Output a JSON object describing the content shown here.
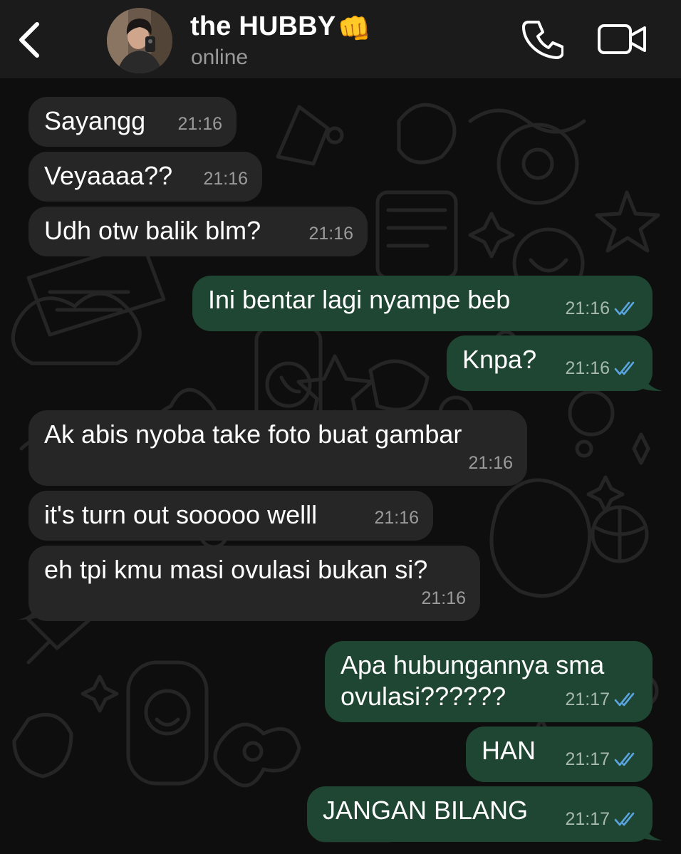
{
  "header": {
    "contact_name": "the HUBBY",
    "contact_emoji": "👊",
    "status": "online",
    "icons": {
      "back": "chevron-left-icon",
      "call": "phone-icon",
      "video": "video-camera-icon"
    }
  },
  "messages": [
    {
      "direction": "in",
      "text": "Sayangg",
      "time": "21:16"
    },
    {
      "direction": "in",
      "text": "Veyaaaa??",
      "time": "21:16"
    },
    {
      "direction": "in",
      "text": "Udh otw balik blm?",
      "time": "21:16"
    },
    {
      "direction": "out",
      "text": "Ini bentar lagi nyampe beb",
      "time": "21:16",
      "read": true
    },
    {
      "direction": "out",
      "text": "Knpa?",
      "time": "21:16",
      "read": true
    },
    {
      "direction": "in",
      "text": "Ak abis nyoba take foto buat gambar",
      "time": "21:16"
    },
    {
      "direction": "in",
      "text": "it's turn out sooooo welll",
      "time": "21:16"
    },
    {
      "direction": "in",
      "text": "eh tpi kmu masi ovulasi bukan si?",
      "time": "21:16"
    },
    {
      "direction": "out",
      "text": "Apa hubungannya sma\novulasi??????",
      "time": "21:17",
      "read": true
    },
    {
      "direction": "out",
      "text": "HAN",
      "time": "21:17",
      "read": true
    },
    {
      "direction": "out",
      "text": "JANGAN BILANG",
      "time": "21:17",
      "read": true
    }
  ],
  "colors": {
    "header_bg": "#1b1b1b",
    "incoming_bubble": "#262626",
    "outgoing_bubble": "#1e4632",
    "read_ticks": "#5aa4e0"
  }
}
